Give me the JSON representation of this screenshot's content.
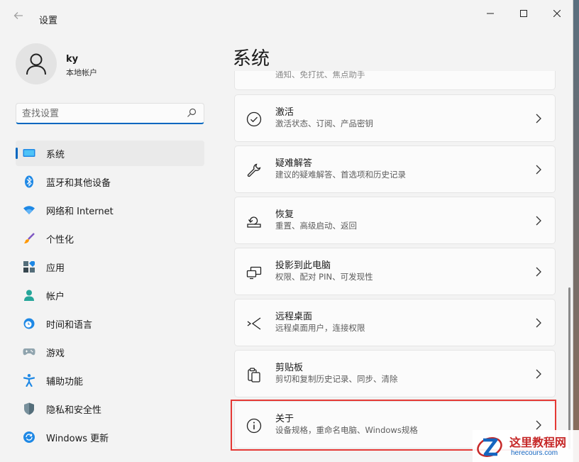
{
  "window": {
    "title": "设置",
    "back_icon": "arrow-left-icon",
    "min_glyph": "—",
    "max_glyph": "☐",
    "close_glyph": "✕"
  },
  "profile": {
    "name": "ky",
    "account_type": "本地帐户"
  },
  "search": {
    "placeholder": "查找设置",
    "value": ""
  },
  "accent_color": "#0067c0",
  "nav": {
    "items": [
      {
        "label": "系统",
        "icon": "system-icon",
        "active": true
      },
      {
        "label": "蓝牙和其他设备",
        "icon": "bluetooth-icon"
      },
      {
        "label": "网络和 Internet",
        "icon": "wifi-icon"
      },
      {
        "label": "个性化",
        "icon": "brush-icon"
      },
      {
        "label": "应用",
        "icon": "apps-icon"
      },
      {
        "label": "帐户",
        "icon": "account-icon"
      },
      {
        "label": "时间和语言",
        "icon": "clock-globe-icon"
      },
      {
        "label": "游戏",
        "icon": "gamepad-icon"
      },
      {
        "label": "辅助功能",
        "icon": "accessibility-icon"
      },
      {
        "label": "隐私和安全性",
        "icon": "shield-icon"
      },
      {
        "label": "Windows 更新",
        "icon": "update-icon"
      }
    ]
  },
  "main": {
    "page_title": "系统",
    "partial_top_text": "通知、免打扰、焦点助手",
    "cards": [
      {
        "title": "激活",
        "subtitle": "激活状态、订阅、产品密钥",
        "icon": "check-circle-icon"
      },
      {
        "title": "疑难解答",
        "subtitle": "建议的疑难解答、首选项和历史记录",
        "icon": "wrench-icon"
      },
      {
        "title": "恢复",
        "subtitle": "重置、高级启动、返回",
        "icon": "recovery-icon"
      },
      {
        "title": "投影到此电脑",
        "subtitle": "权限、配对 PIN、可发现性",
        "icon": "project-icon"
      },
      {
        "title": "远程桌面",
        "subtitle": "远程桌面用户，连接权限",
        "icon": "remote-desktop-icon"
      },
      {
        "title": "剪贴板",
        "subtitle": "剪切和复制历史记录、同步、清除",
        "icon": "clipboard-icon"
      },
      {
        "title": "关于",
        "subtitle": "设备规格，重命名电脑、Windows规格",
        "icon": "info-icon",
        "highlighted": true
      }
    ]
  },
  "watermark": {
    "text": "这里教程网",
    "url": "herecours.com"
  }
}
